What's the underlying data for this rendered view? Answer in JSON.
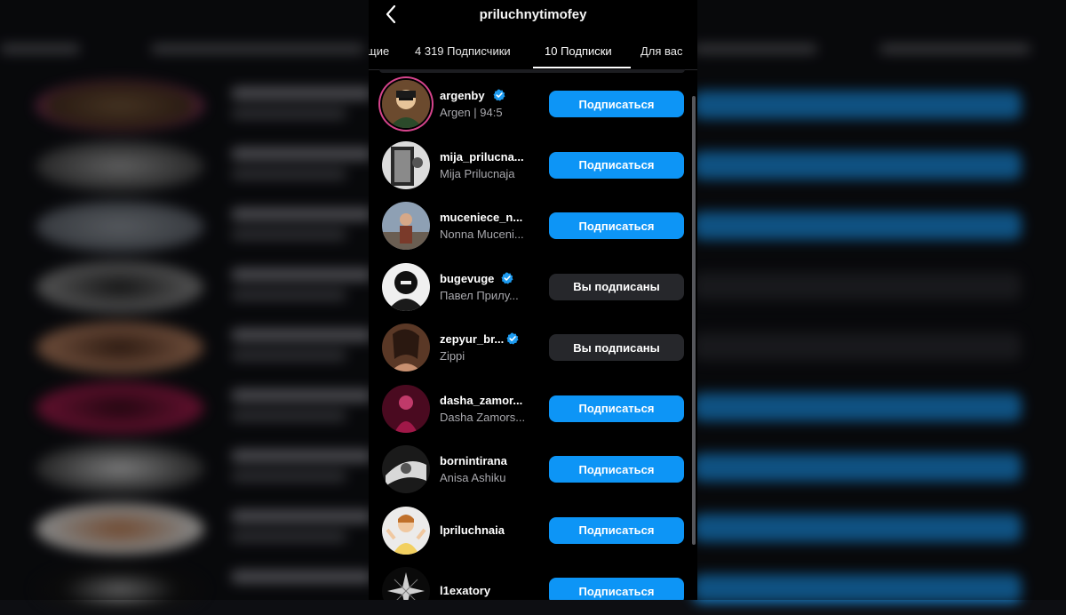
{
  "header": {
    "title": "priluchnytimofey"
  },
  "tabs": [
    {
      "label": "щие"
    },
    {
      "label": "4 319 Подписчики"
    },
    {
      "label": "10 Подписки",
      "active": true
    },
    {
      "label": "Для вас"
    }
  ],
  "users": [
    {
      "username": "argenby",
      "verified": true,
      "fullname": "Argen | 94:5",
      "button": "Подписаться",
      "state": "follow",
      "avatar": "person-icon"
    },
    {
      "username": "mija_prilucna...",
      "verified": false,
      "fullname": "Mija Prilucnaja",
      "button": "Подписаться",
      "state": "follow",
      "avatar": "person-icon"
    },
    {
      "username": "muceniece_n...",
      "verified": false,
      "fullname": "Nonna Muceni...",
      "button": "Подписаться",
      "state": "follow",
      "avatar": "person-icon"
    },
    {
      "username": "bugevuge",
      "verified": true,
      "fullname": "Павел Прилу...",
      "button": "Вы подписаны",
      "state": "following",
      "avatar": "person-icon"
    },
    {
      "username": "zepyur_br...",
      "verified": true,
      "fullname": "Zippi",
      "button": "Вы подписаны",
      "state": "following",
      "avatar": "person-icon"
    },
    {
      "username": "dasha_zamor...",
      "verified": false,
      "fullname": "Dasha Zamors...",
      "button": "Подписаться",
      "state": "follow",
      "avatar": "person-icon"
    },
    {
      "username": "bornintirana",
      "verified": false,
      "fullname": "Anisa Ashiku",
      "button": "Подписаться",
      "state": "follow",
      "avatar": "person-icon"
    },
    {
      "username": "lpriluchnaia",
      "verified": false,
      "fullname": "",
      "button": "Подписаться",
      "state": "follow",
      "avatar": "person-icon"
    },
    {
      "username": "l1exatory",
      "verified": false,
      "fullname": "",
      "button": "Подписаться",
      "state": "follow",
      "avatar": "star-icon"
    }
  ],
  "colors": {
    "follow": "#0d95f6",
    "following": "#26272b",
    "verified": "#1d9bf0",
    "background": "#000000"
  }
}
